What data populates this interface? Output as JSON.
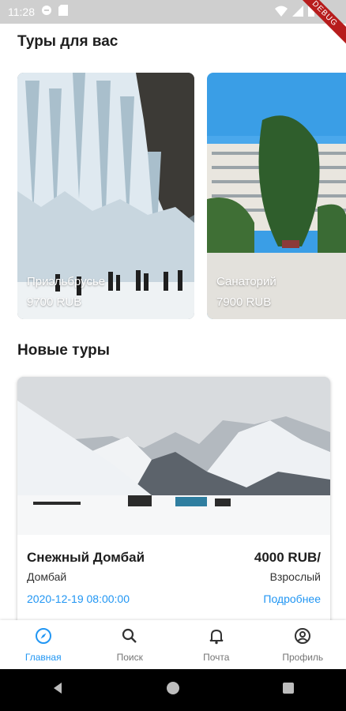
{
  "status_bar": {
    "time": "11:28",
    "debug_label": "DEBUG"
  },
  "sections": {
    "for_you_title": "Туры для вас",
    "new_tours_title": "Новые туры"
  },
  "featured_tours": [
    {
      "name": "Приэльбрусье",
      "price": "9700 RUB"
    },
    {
      "name": "Санаторий",
      "price": "7900 RUB"
    }
  ],
  "new_tour": {
    "name": "Снежный Домбай",
    "price": "4000 RUB/",
    "place": "Домбай",
    "per": "Взрослый",
    "date": "2020-12-19 08:00:00",
    "more_label": "Подробнее"
  },
  "bottom_nav": [
    {
      "label": "Главная",
      "icon": "compass-icon",
      "active": true
    },
    {
      "label": "Поиск",
      "icon": "search-icon",
      "active": false
    },
    {
      "label": "Почта",
      "icon": "bell-icon",
      "active": false
    },
    {
      "label": "Профиль",
      "icon": "account-icon",
      "active": false
    }
  ],
  "colors": {
    "accent": "#2196f3",
    "text": "#1e1e1e",
    "status_bar": "#cfcfcf",
    "debug": "#b71c1c"
  }
}
